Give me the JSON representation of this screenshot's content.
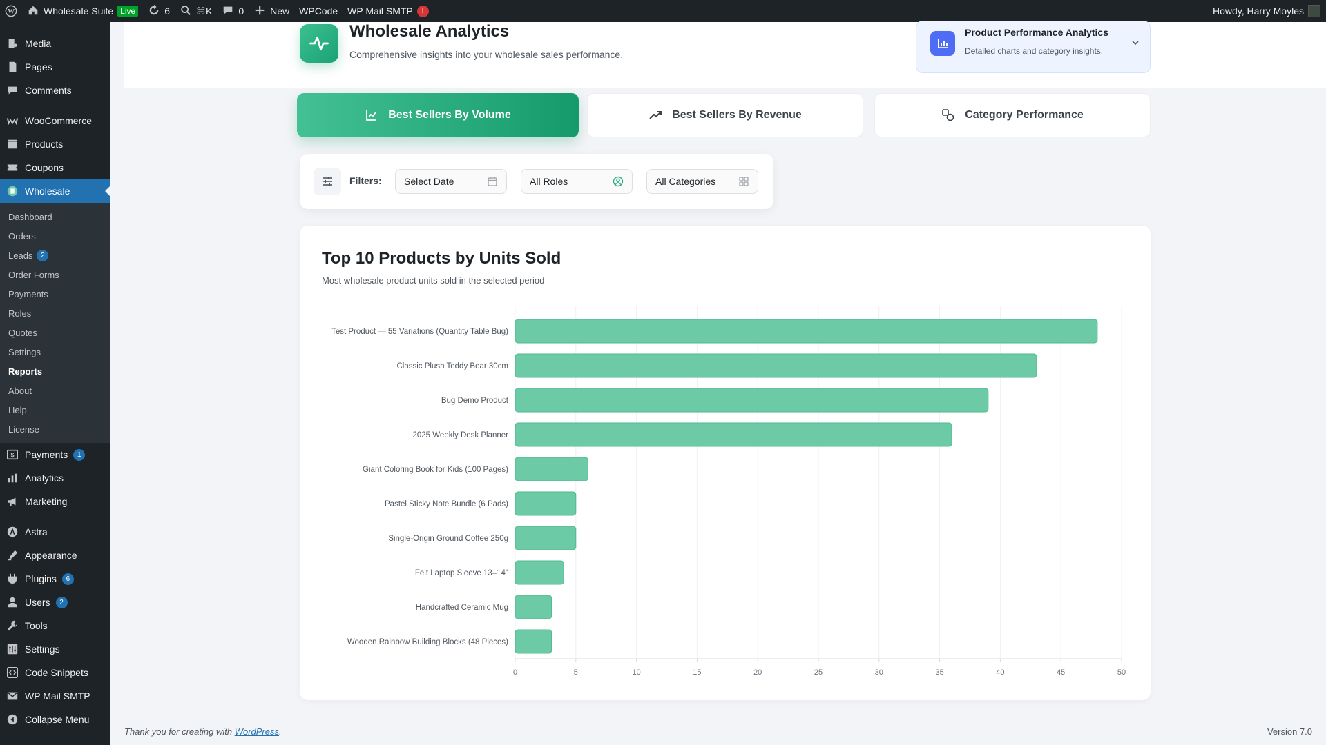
{
  "adminbar": {
    "site_name": "Wholesale Suite",
    "live_badge": "Live",
    "updates_count": "6",
    "shortcut": "⌘K",
    "comments_count": "0",
    "new_label": "New",
    "wpcode_label": "WPCode",
    "wpmail_label": "WP Mail SMTP",
    "wpmail_alert": "!",
    "howdy": "Howdy, Harry Moyles"
  },
  "sidebar": {
    "items_top": [
      {
        "label": "Media",
        "icon": "media-icon"
      },
      {
        "label": "Pages",
        "icon": "pages-icon"
      },
      {
        "label": "Comments",
        "icon": "comments-icon"
      }
    ],
    "items_shop": [
      {
        "label": "WooCommerce",
        "icon": "woocommerce-icon"
      },
      {
        "label": "Products",
        "icon": "products-icon"
      },
      {
        "label": "Coupons",
        "icon": "coupons-icon"
      }
    ],
    "wholesale_label": "Wholesale",
    "submenu": [
      {
        "label": "Dashboard"
      },
      {
        "label": "Orders"
      },
      {
        "label": "Leads",
        "badge": "2"
      },
      {
        "label": "Order Forms"
      },
      {
        "label": "Payments"
      },
      {
        "label": "Roles"
      },
      {
        "label": "Quotes"
      },
      {
        "label": "Settings"
      },
      {
        "label": "Reports",
        "current": true
      },
      {
        "label": "About"
      },
      {
        "label": "Help"
      },
      {
        "label": "License"
      }
    ],
    "items_mid": [
      {
        "label": "Payments",
        "icon": "payments-icon",
        "badge": "1"
      },
      {
        "label": "Analytics",
        "icon": "analytics-icon"
      },
      {
        "label": "Marketing",
        "icon": "marketing-icon"
      }
    ],
    "items_bottom": [
      {
        "label": "Astra",
        "icon": "astra-icon"
      },
      {
        "label": "Appearance",
        "icon": "appearance-icon"
      },
      {
        "label": "Plugins",
        "icon": "plugins-icon",
        "badge": "6"
      },
      {
        "label": "Users",
        "icon": "users-icon",
        "badge": "2"
      },
      {
        "label": "Tools",
        "icon": "tools-icon"
      },
      {
        "label": "Settings",
        "icon": "settings-icon"
      },
      {
        "label": "Code Snippets",
        "icon": "code-snippets-icon"
      },
      {
        "label": "WP Mail SMTP",
        "icon": "mail-icon"
      },
      {
        "label": "Collapse Menu",
        "icon": "collapse-icon"
      }
    ]
  },
  "header": {
    "title": "Wholesale Analytics",
    "subtitle": "Comprehensive insights into your wholesale sales performance.",
    "card_title": "Product Performance Analytics",
    "card_subtitle": "Detailed charts and category insights."
  },
  "tabs": [
    {
      "label": "Best Sellers By Volume",
      "active": true
    },
    {
      "label": "Best Sellers By Revenue",
      "active": false
    },
    {
      "label": "Category Performance",
      "active": false
    }
  ],
  "filters": {
    "label": "Filters:",
    "date": "Select Date",
    "roles": "All Roles",
    "categories": "All Categories"
  },
  "chart_card": {
    "title": "Top 10 Products by Units Sold",
    "subtitle": "Most wholesale product units sold in the selected period"
  },
  "chart_data": {
    "type": "bar",
    "orientation": "horizontal",
    "categories": [
      "Test Product — 55 Variations (Quantity Table Bug)",
      "Classic Plush Teddy Bear 30cm",
      "Bug Demo Product",
      "2025 Weekly Desk Planner",
      "Giant Coloring Book for Kids (100 Pages)",
      "Pastel Sticky Note Bundle (6 Pads)",
      "Single-Origin Ground Coffee 250g",
      "Felt Laptop Sleeve 13–14\"",
      "Handcrafted Ceramic Mug",
      "Wooden Rainbow Building Blocks (48 Pieces)"
    ],
    "values": [
      48,
      43,
      39,
      36,
      6,
      5,
      5,
      4,
      3,
      3
    ],
    "xlim": [
      0,
      50
    ],
    "xticks": [
      0,
      5,
      10,
      15,
      20,
      25,
      30,
      35,
      40,
      45,
      50
    ],
    "grid": true,
    "bar_color": "#6ccba6",
    "bar_stroke": "#4fb88e"
  },
  "footer": {
    "text_before": "Thank you for creating with ",
    "link": "WordPress",
    "text_after": ".",
    "version": "Version 7.0"
  }
}
